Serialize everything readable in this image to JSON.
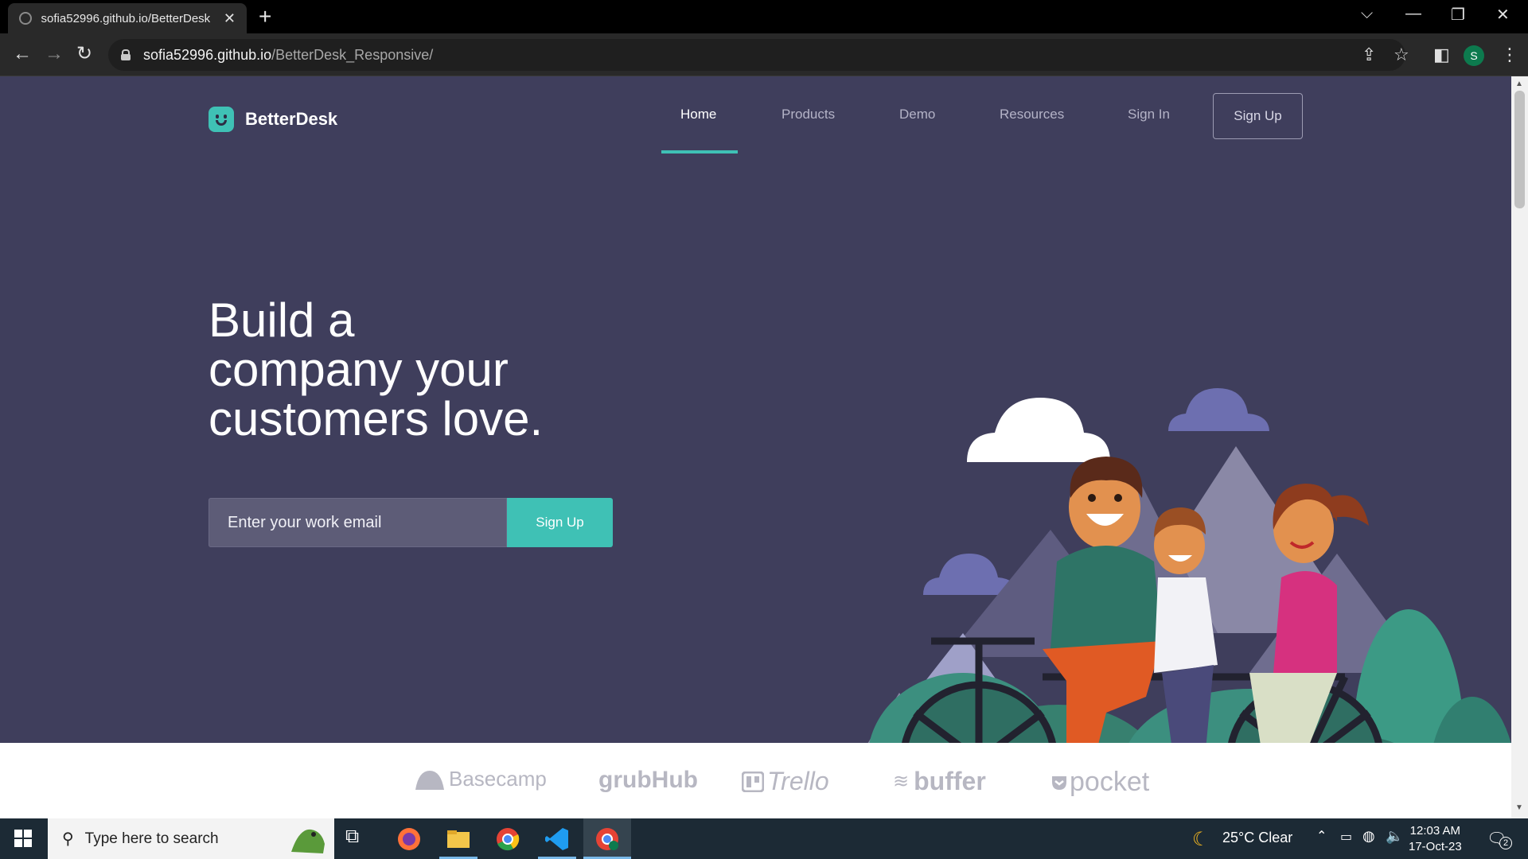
{
  "browser": {
    "tab_title": "sofia52996.github.io/BetterDesk",
    "url_host": "sofia52996.github.io",
    "url_path": "/BetterDesk_Responsive/",
    "profile_initial": "S"
  },
  "site": {
    "brand": "BetterDesk",
    "nav": [
      {
        "label": "Home",
        "active": true
      },
      {
        "label": "Products"
      },
      {
        "label": "Demo"
      },
      {
        "label": "Resources"
      },
      {
        "label": "Sign In"
      }
    ],
    "nav_signup": "Sign Up",
    "hero": {
      "title_line1": "Build a",
      "title_line2": "company your",
      "title_line3": "customers love.",
      "email_placeholder": "Enter your work email",
      "signup_button": "Sign Up"
    },
    "partner_logos": [
      "Basecamp",
      "grubHub",
      "Trello",
      "buffer",
      "pocket"
    ]
  },
  "taskbar": {
    "search_placeholder": "Type here to search",
    "weather": "25°C  Clear",
    "time": "12:03 AM",
    "date": "17-Oct-23",
    "notification_count": "2"
  },
  "colors": {
    "page_bg": "#3f3e5c",
    "accent": "#3fc1b5",
    "browser_bg": "#292929",
    "taskbar_bg": "#1c2a35"
  }
}
